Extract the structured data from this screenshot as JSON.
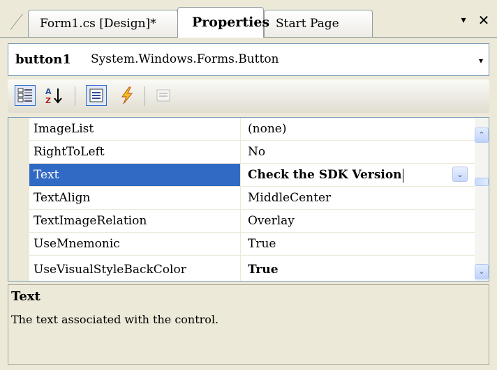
{
  "tabs": [
    {
      "label": "Form1.cs [Design]*"
    },
    {
      "label": "Properties"
    },
    {
      "label": "Start Page"
    }
  ],
  "window_buttons": {
    "dropdown": "▾",
    "close": "✕"
  },
  "object_selector": {
    "name": "button1",
    "type": "System.Windows.Forms.Button",
    "dropdown": "▾"
  },
  "toolbar": {
    "buttons": [
      "categorized-icon",
      "alphabetical-icon",
      "properties-icon",
      "events-icon",
      "property-pages-icon"
    ]
  },
  "properties": [
    {
      "name": "ImageList",
      "value": "(none)"
    },
    {
      "name": "RightToLeft",
      "value": "No"
    },
    {
      "name": "Text",
      "value": "Check the SDK Version"
    },
    {
      "name": "TextAlign",
      "value": "MiddleCenter"
    },
    {
      "name": "TextImageRelation",
      "value": "Overlay"
    },
    {
      "name": "UseMnemonic",
      "value": "True"
    },
    {
      "name": "UseVisualStyleBackColor",
      "value": "True"
    }
  ],
  "scrollbar": {
    "up": "⌃",
    "down": "⌄"
  },
  "value_dropdown": "⌄",
  "description": {
    "title": "Text",
    "body": "The text associated with the control."
  },
  "colors": {
    "selection": "#316AC5",
    "panel": "#ECE9D8",
    "border": "#7F9DB9"
  }
}
